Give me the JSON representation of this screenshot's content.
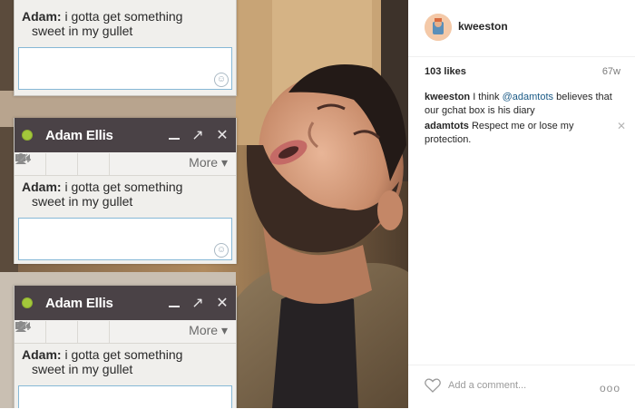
{
  "chat": {
    "top_message": {
      "sender": "Adam:",
      "line1": "i gotta get something",
      "line2": "sweet in my gullet"
    },
    "boxes": [
      {
        "name": "Adam Ellis",
        "more_label": "More",
        "sender": "Adam:",
        "line1": "i gotta get something",
        "line2": "sweet in my gullet"
      },
      {
        "name": "Adam Ellis",
        "more_label": "More",
        "sender": "Adam:",
        "line1": "i gotta get something",
        "line2": "sweet in my gullet"
      }
    ],
    "status_color": "#a3c83b",
    "header_color": "#4a4246"
  },
  "instagram": {
    "username": "kweeston",
    "likes": "103 likes",
    "time_ago": "67w",
    "comments": [
      {
        "user": "kweeston",
        "pre": " I think ",
        "mention": "@adamtots",
        "post": " believes that our gchat box is his diary"
      },
      {
        "user": "adamtots",
        "pre": " Respect me or lose my protection.",
        "mention": "",
        "post": ""
      }
    ],
    "add_comment_placeholder": "Add a comment...",
    "more_dots": "ooo"
  }
}
